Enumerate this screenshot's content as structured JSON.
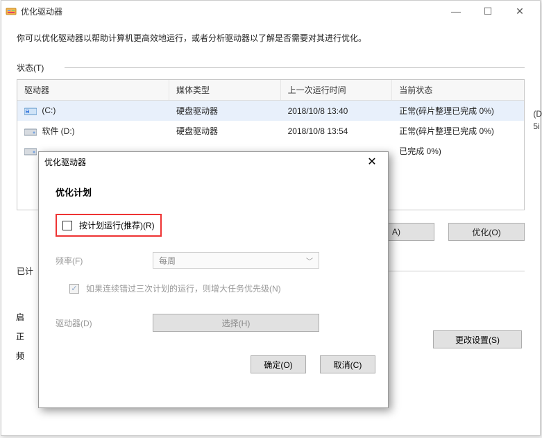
{
  "window": {
    "title": "优化驱动器",
    "description": "你可以优化驱动器以帮助计算机更高效地运行，或者分析驱动器以了解是否需要对其进行优化。",
    "status_label": "状态(T)"
  },
  "table": {
    "headers": {
      "drive": "驱动器",
      "media": "媒体类型",
      "last": "上一次运行时间",
      "state": "当前状态"
    },
    "rows": [
      {
        "icon": "os",
        "drive": "(C:)",
        "media": "硬盘驱动器",
        "last": "2018/10/8 13:40",
        "state": "正常(碎片整理已完成 0%)",
        "selected": true
      },
      {
        "icon": "hdd",
        "drive": "软件 (D:)",
        "media": "硬盘驱动器",
        "last": "2018/10/8 13:54",
        "state": "正常(碎片整理已完成 0%)",
        "selected": false
      },
      {
        "icon": "hdd",
        "drive": "",
        "media": "",
        "last": "",
        "state": "已完成 0%)",
        "selected": false
      }
    ]
  },
  "buttons": {
    "analyze": "A)",
    "optimize": "优化(O)",
    "change_settings": "更改设置(S)"
  },
  "sched_labels": {
    "planned": "已计",
    "on": "启",
    "ok": "正",
    "freq": "频"
  },
  "dialog": {
    "title": "优化驱动器",
    "section": "优化计划",
    "run_schedule": "按计划运行(推荐)(R)",
    "freq_label": "频率(F)",
    "freq_value": "每周",
    "sub_check": "如果连续错过三次计划的运行，则增大任务优先级(N)",
    "drive_label": "驱动器(D)",
    "choose_btn": "选择(H)",
    "ok": "确定(O)",
    "cancel": "取消(C)"
  },
  "right_snip": {
    "l1": "(D",
    "l2": "5i"
  }
}
